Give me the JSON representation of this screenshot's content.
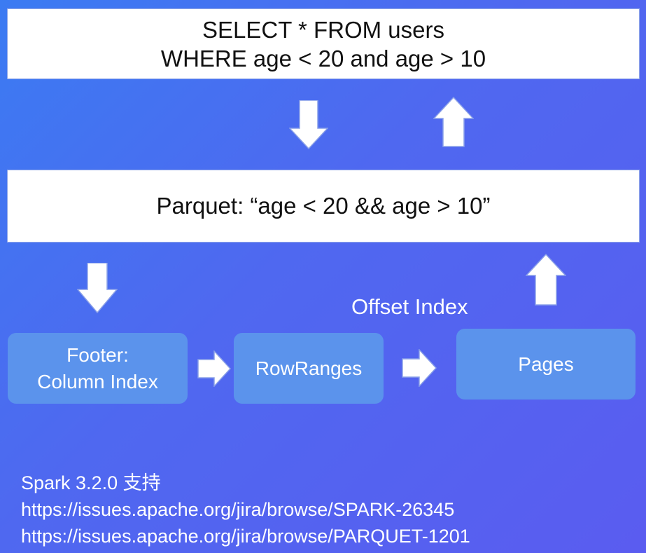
{
  "sql_box": {
    "line1": "SELECT * FROM users",
    "line2": "WHERE age < 20 and age > 10"
  },
  "parquet_box": {
    "text": "Parquet: “age < 20 && age > 10”"
  },
  "footer_box": {
    "line1": "Footer:",
    "line2": "Column Index"
  },
  "rowranges_box": {
    "text": "RowRanges"
  },
  "pages_box": {
    "text": "Pages"
  },
  "offset_index_label": "Offset Index",
  "notes": {
    "line1": "Spark 3.2.0 支持",
    "line2": "https://issues.apache.org/jira/browse/SPARK-26345",
    "line3": "https://issues.apache.org/jira/browse/PARQUET-1201"
  },
  "colors": {
    "background_start": "#3b7bf2",
    "background_end": "#5a5cf0",
    "white_box": "#ffffff",
    "blue_box": "#5b93ec",
    "arrow_fill": "#ffffff"
  }
}
